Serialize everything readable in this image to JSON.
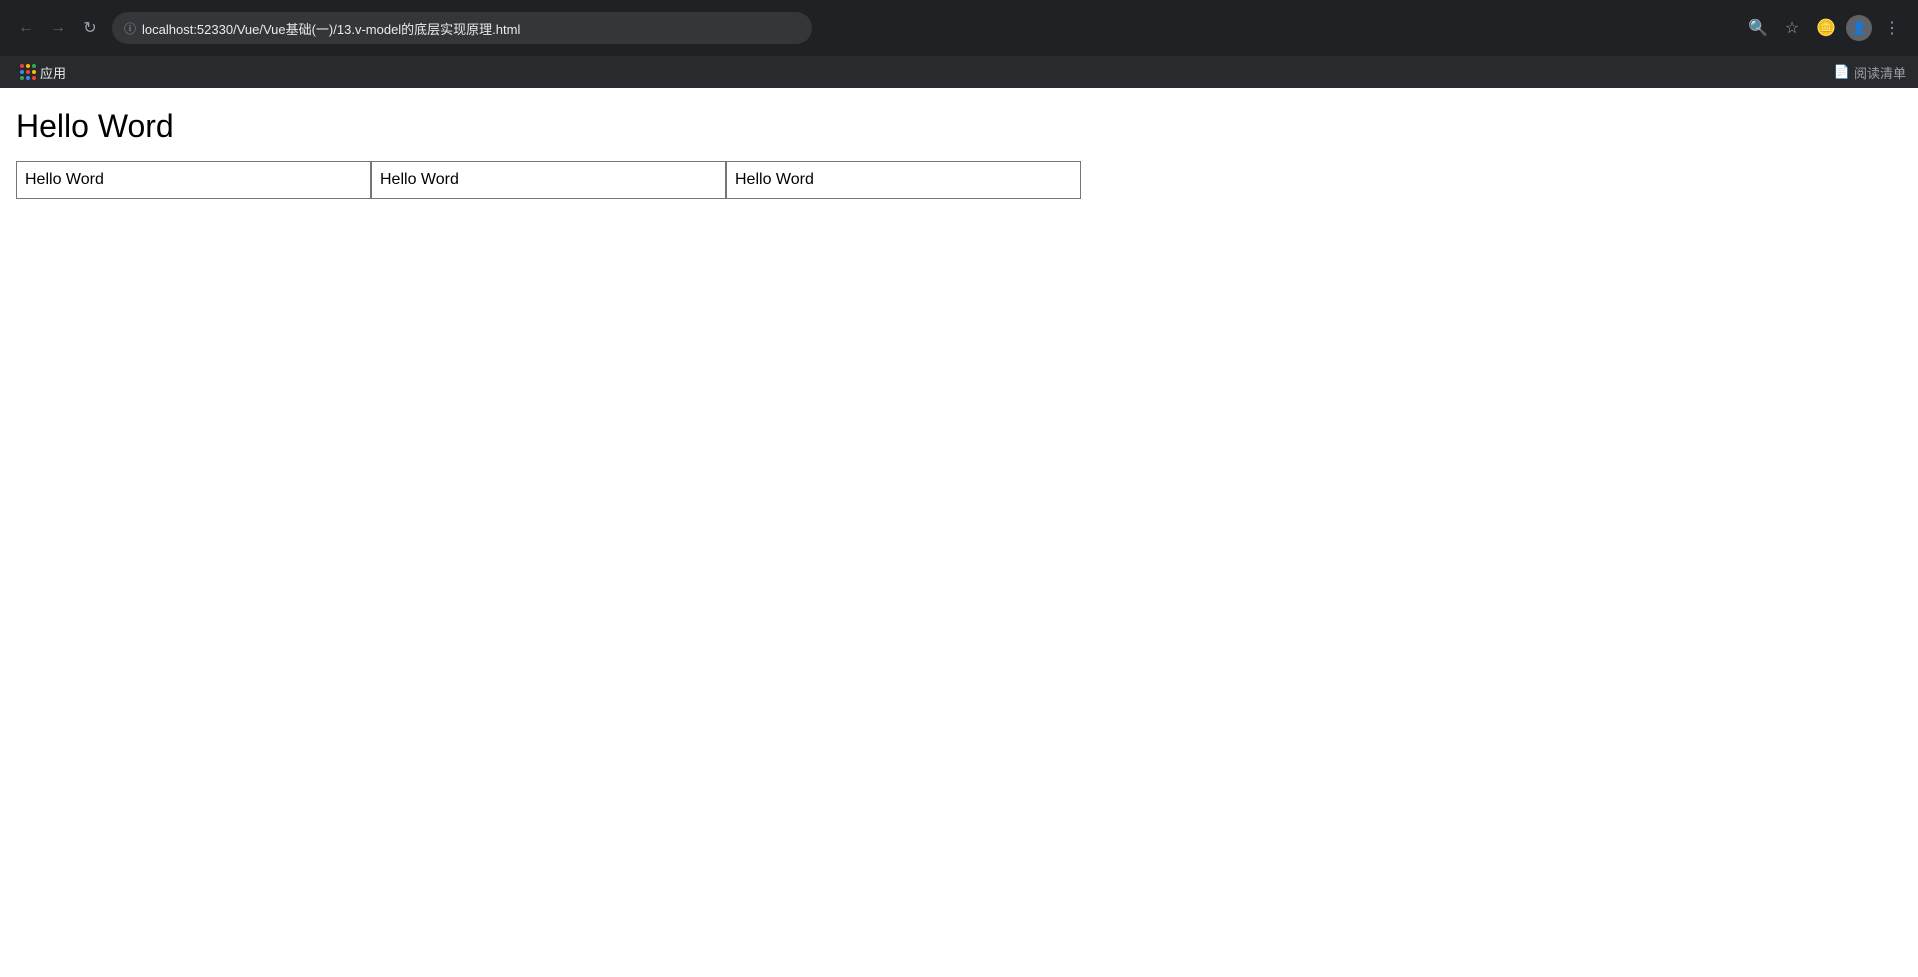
{
  "browser": {
    "url": "localhost:52330/Vue/Vue基础(一)/13.v-model的底层实现原理.html",
    "nav": {
      "back_disabled": true,
      "forward_disabled": true
    },
    "bookmarks_bar": {
      "apps_label": "应用"
    },
    "reader_label": "阅读清单"
  },
  "page": {
    "title": "Hello Word",
    "inputs": [
      {
        "value": "Hello Word"
      },
      {
        "value": "Hello Word"
      },
      {
        "value": "Hello Word"
      }
    ]
  }
}
